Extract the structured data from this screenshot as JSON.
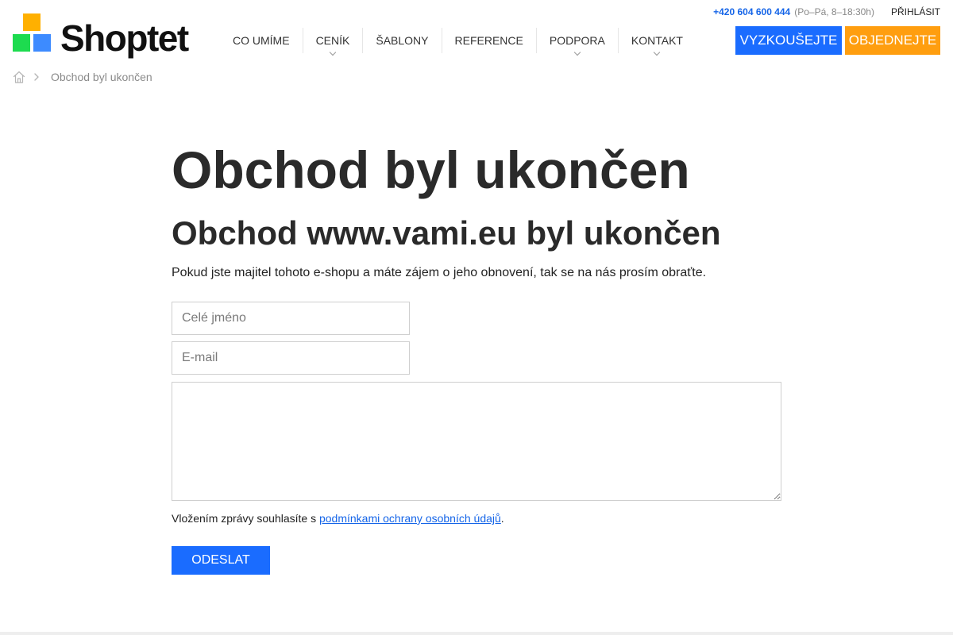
{
  "brand": {
    "name": "Shoptet",
    "colors": {
      "square_top": "#ffb000",
      "square_left": "#1ddb4f",
      "square_right": "#3d8bff"
    }
  },
  "topbar": {
    "phone": "+420 604 600 444",
    "hours": "(Po–Pá, 8–18:30h)",
    "login": "PŘIHLÁSIT"
  },
  "nav": {
    "items": [
      {
        "label": "CO UMÍME",
        "dropdown": false
      },
      {
        "label": "CENÍK",
        "dropdown": true
      },
      {
        "label": "ŠABLONY",
        "dropdown": false
      },
      {
        "label": "REFERENCE",
        "dropdown": false
      },
      {
        "label": "PODPORA",
        "dropdown": true
      },
      {
        "label": "KONTAKT",
        "dropdown": true
      }
    ]
  },
  "cta": {
    "try_label": "VYZKOUŠEJTE",
    "order_label": "OBJEDNEJTE",
    "try_color": "#1a6cff",
    "order_color": "#ff9e0f"
  },
  "breadcrumb": {
    "home_icon": "home-icon",
    "current": "Obchod byl ukončen"
  },
  "main": {
    "title": "Obchod byl ukončen",
    "subtitle": "Obchod www.vami.eu byl ukončen",
    "lead": "Pokud jste majitel tohoto e-shopu a máte zájem o jeho obnovení, tak se na nás prosím obraťte."
  },
  "form": {
    "name_placeholder": "Celé jméno",
    "name_value": "",
    "email_placeholder": "E-mail",
    "email_value": "",
    "message_value": "",
    "consent_prefix": "Vložením zprávy souhlasíte s ",
    "consent_link": "podmínkami ochrany osobních údajů",
    "consent_suffix": ".",
    "submit_label": "ODESLAT"
  }
}
